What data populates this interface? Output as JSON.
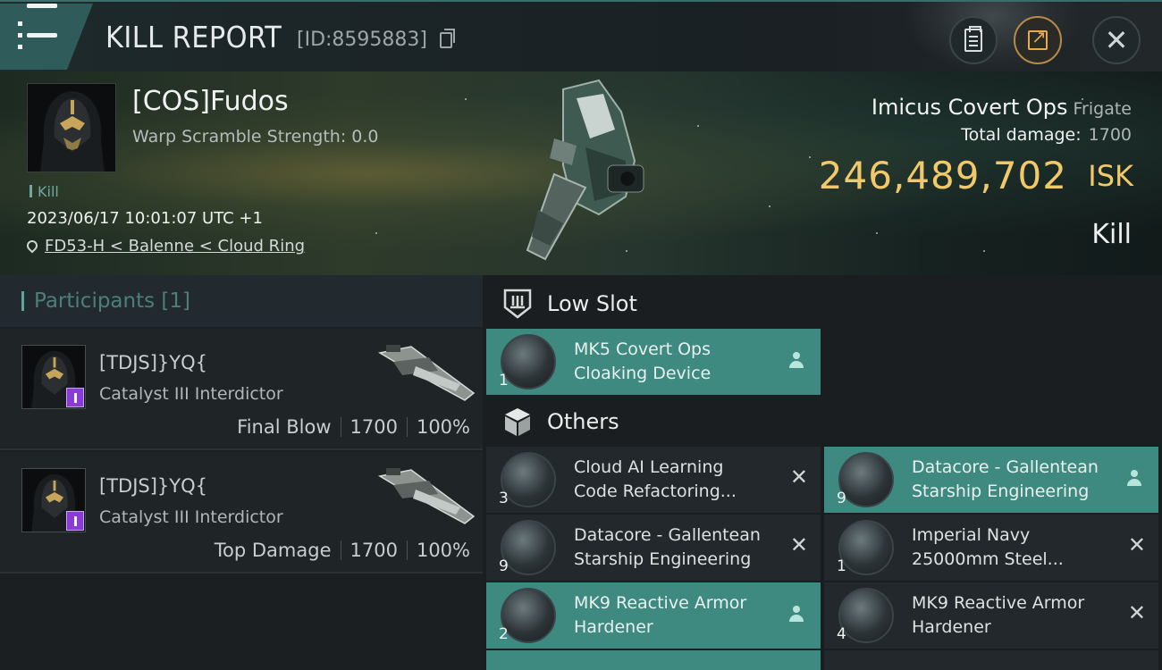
{
  "header": {
    "title": "KILL REPORT",
    "report_id": "[ID:8595883]",
    "buttons": [
      "clipboard-icon",
      "export-icon",
      "close-icon"
    ],
    "accent_color": "#2f5c5a",
    "export_color": "#e8a94f"
  },
  "victim": {
    "name": "[COS]Fudos",
    "warp_scramble": "Warp Scramble Strength: 0.0",
    "type_tag": "Kill",
    "datetime": "2023/06/17 10:01:07 UTC +1",
    "location": "FD53-H < Balenne < Cloud Ring",
    "ship_name": "Imicus Covert Ops",
    "ship_class": "Frigate",
    "total_damage_label": "Total damage:",
    "total_damage": "1700",
    "isk_value": "246,489,702",
    "isk_unit": "ISK",
    "result": "Kill",
    "isk_color": "#f2c96a"
  },
  "participants": {
    "title": "Participants [1]",
    "rows": [
      {
        "name": "[TDJS]}YQ{",
        "ship": "Catalyst III Interdictor",
        "role": "Final Blow",
        "damage": "1700",
        "percent": "100%"
      },
      {
        "name": "[TDJS]}YQ{",
        "ship": "Catalyst III Interdictor",
        "role": "Top Damage",
        "damage": "1700",
        "percent": "100%"
      }
    ]
  },
  "fitting": {
    "low_slot_label": "Low Slot",
    "others_label": "Others",
    "low_slot_items": [
      {
        "qty": "1",
        "name_l1": "MK5 Covert Ops",
        "name_l2": "Cloaking Device",
        "status": "fitted",
        "highlight": true
      }
    ],
    "others_items": [
      {
        "qty": "3",
        "name_l1": "Cloud AI Learning",
        "name_l2": "Code Refactoring...",
        "status": "destroyed",
        "highlight": false
      },
      {
        "qty": "9",
        "name_l1": "Datacore - Gallentean",
        "name_l2": "Starship Engineering",
        "status": "dropped",
        "highlight": true
      },
      {
        "qty": "9",
        "name_l1": "Datacore - Gallentean",
        "name_l2": "Starship Engineering",
        "status": "destroyed",
        "highlight": false
      },
      {
        "qty": "1",
        "name_l1": "Imperial Navy",
        "name_l2": "25000mm Steel...",
        "status": "destroyed",
        "highlight": false
      },
      {
        "qty": "2",
        "name_l1": "MK9 Reactive Armor",
        "name_l2": "Hardener",
        "status": "dropped",
        "highlight": true
      },
      {
        "qty": "4",
        "name_l1": "MK9 Reactive Armor",
        "name_l2": "Hardener",
        "status": "destroyed",
        "highlight": false
      }
    ],
    "highlight_color": "#3f8a80"
  }
}
